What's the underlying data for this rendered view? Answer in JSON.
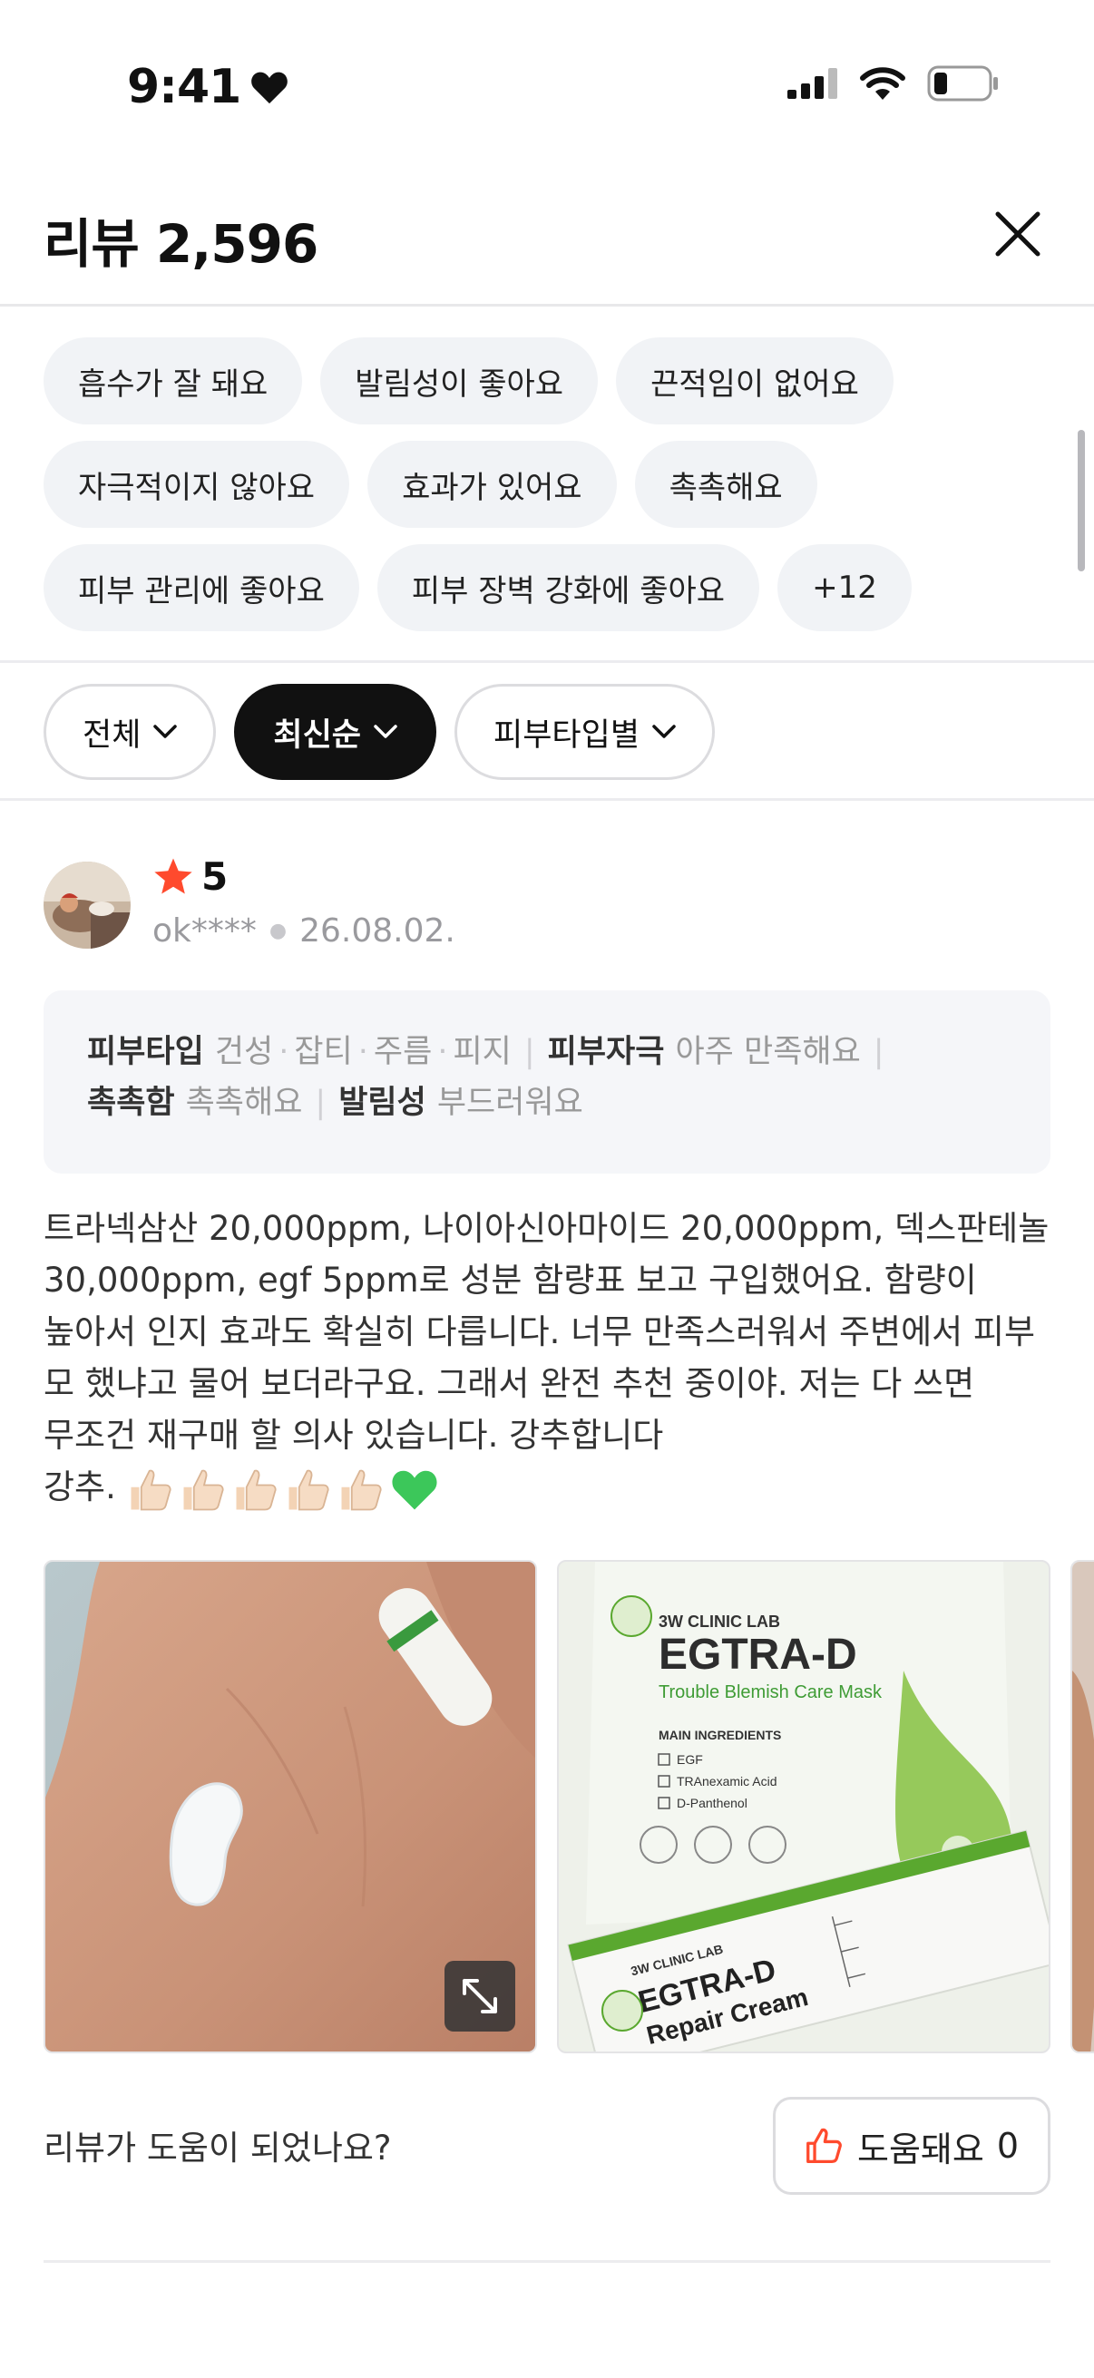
{
  "status": {
    "time": "9:41"
  },
  "header": {
    "title": "리뷰 2,596"
  },
  "chips": [
    "흡수가 잘 돼요",
    "발림성이 좋아요",
    "끈적임이 없어요",
    "자극적이지 않아요",
    "효과가 있어요",
    "촉촉해요",
    "피부 관리에 좋아요",
    "피부 장벽 강화에 좋아요",
    "+12"
  ],
  "filters": {
    "all": "전체",
    "latest": "최신순",
    "skin_type": "피부타입별"
  },
  "review": {
    "rating": "5",
    "user": "ok****",
    "date": "26.08.02.",
    "skin_type_label": "피부타입",
    "skin_types": [
      "건성",
      "잡티",
      "주름",
      "피지"
    ],
    "irritation_label": "피부자극",
    "irritation_value": "아주 만족해요",
    "moisture_label": "촉촉함",
    "moisture_value": "촉촉해요",
    "spread_label": "발림성",
    "spread_value": "부드러워요",
    "text_lines": [
      "트라넥삼산 20,000ppm, 나이아신아마이드 20,000ppm, 덱스판테놀",
      "30,000ppm, egf 5ppm로 성분 함량표 보고 구입했어요. 함량이",
      "높아서 인지 효과도 확실히 다릅니다. 너무 만족스러워서 주변에서 피부",
      "모 했냐고 물어 보더라구요. 그래서 완전 추천 중이야. 저는 다 쓰면",
      "무조건 재구매 할 의사 있습니다. 강추합니다"
    ],
    "text_last": "강추."
  },
  "photo2": {
    "brand": "3W CLINIC LAB",
    "title": "EGTRA-D",
    "subtitle": "Trouble Blemish Care Mask",
    "ingredients_header": "MAIN INGREDIENTS",
    "ingredients": [
      "EGF",
      "TRAnexamic Acid",
      "D-Panthenol"
    ],
    "box_brand": "3W CLINIC LAB",
    "box_title": "EGTRA-D",
    "box_subtitle": "Repair Cream"
  },
  "helpful": {
    "question": "리뷰가 도움이 되었나요?",
    "label": "도움돼요",
    "count": "0"
  },
  "colors": {
    "accent": "#ff4a2d",
    "active_filter": "#111111",
    "chip_bg": "#f1f3f6"
  }
}
